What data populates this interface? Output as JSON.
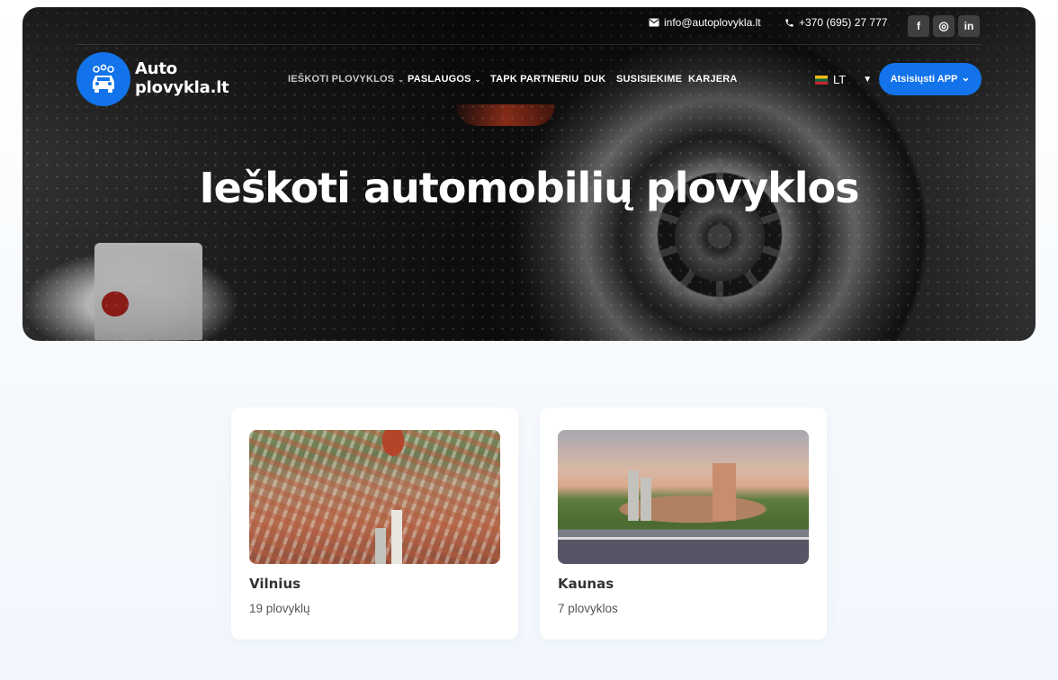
{
  "topbar": {
    "email": "info@autoplovykla.lt",
    "phone": "+370 (695) 27 777",
    "social": [
      {
        "icon": "facebook-icon",
        "glyph": "f"
      },
      {
        "icon": "instagram-icon",
        "glyph": "◎"
      },
      {
        "icon": "linkedin-icon",
        "glyph": "in"
      }
    ]
  },
  "logo": {
    "line1": "Auto",
    "line2": "plovykla.lt",
    "color": "#1273eb"
  },
  "nav": {
    "items": [
      {
        "label": "IEŠKOTI PLOVYKLOS",
        "active": true,
        "dropdown": true
      },
      {
        "label": "PASLAUGOS",
        "active": false,
        "dropdown": true
      },
      {
        "label": "TAPK PARTNERIU",
        "active": false,
        "dropdown": false
      },
      {
        "label": "DUK",
        "active": false,
        "dropdown": false
      },
      {
        "label": "SUSISIEKIME",
        "active": false,
        "dropdown": false
      },
      {
        "label": "KARJERA",
        "active": false,
        "dropdown": false
      }
    ],
    "chevron": "⌄"
  },
  "language": {
    "code": "LT",
    "caret": "▼"
  },
  "app_button": {
    "label": "Atsisiųsti APP",
    "chevron": "⌄",
    "color": "#1273eb"
  },
  "hero": {
    "title": "Ieškoti automobilių plovyklos"
  },
  "cities": [
    {
      "name": "Vilnius",
      "count": "19 plovyklų"
    },
    {
      "name": "Kaunas",
      "count": "7 plovyklos"
    }
  ]
}
